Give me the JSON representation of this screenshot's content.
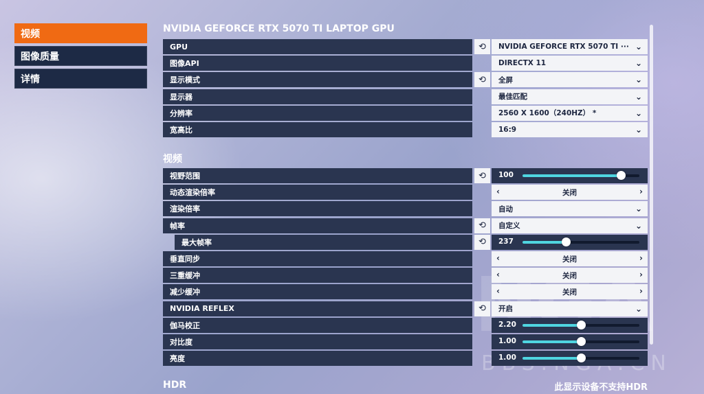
{
  "nav": [
    {
      "label": "视频",
      "active": true
    },
    {
      "label": "图像质量",
      "active": false
    },
    {
      "label": "详情",
      "active": false
    }
  ],
  "gpu_section": {
    "title": "NVIDIA GEFORCE RTX 5070 TI LAPTOP GPU",
    "rows": [
      {
        "label": "GPU",
        "reset": true,
        "type": "dropdown",
        "value": "NVIDIA GEFORCE RTX 5070 TI ···"
      },
      {
        "label": "图像API",
        "reset": false,
        "type": "dropdown",
        "value": "DIRECTX 11"
      },
      {
        "label": "显示模式",
        "reset": true,
        "type": "dropdown",
        "value": "全屏"
      },
      {
        "label": "显示器",
        "reset": false,
        "type": "dropdown",
        "value": "最佳匹配"
      },
      {
        "label": "分辨率",
        "reset": false,
        "type": "dropdown",
        "value": "2560 X 1600（240HZ） *"
      },
      {
        "label": "宽高比",
        "reset": false,
        "type": "dropdown",
        "value": "16:9"
      }
    ]
  },
  "video_section": {
    "title": "视频",
    "rows": [
      {
        "label": "视野范围",
        "reset": true,
        "type": "slider",
        "value": "100",
        "fraction": 0.84
      },
      {
        "label": "动态渲染倍率",
        "reset": false,
        "type": "toggle",
        "value": "关闭"
      },
      {
        "label": "渲染倍率",
        "reset": false,
        "type": "dropdown",
        "value": "自动"
      },
      {
        "label": "帧率",
        "reset": true,
        "type": "dropdown",
        "value": "自定义"
      },
      {
        "label": "最大帧率",
        "reset": true,
        "type": "slider",
        "value": "237",
        "fraction": 0.37,
        "indent": true
      },
      {
        "label": "垂直同步",
        "reset": false,
        "type": "toggle",
        "value": "关闭"
      },
      {
        "label": "三重缓冲",
        "reset": false,
        "type": "toggle",
        "value": "关闭"
      },
      {
        "label": "减少缓冲",
        "reset": false,
        "type": "toggle",
        "value": "关闭"
      },
      {
        "label": "NVIDIA REFLEX",
        "reset": true,
        "type": "dropdown",
        "value": "开启"
      },
      {
        "label": "伽马校正",
        "reset": false,
        "type": "slider",
        "value": "2.20",
        "fraction": 0.5
      },
      {
        "label": "对比度",
        "reset": false,
        "type": "slider",
        "value": "1.00",
        "fraction": 0.5
      },
      {
        "label": "亮度",
        "reset": false,
        "type": "slider",
        "value": "1.00",
        "fraction": 0.5
      }
    ]
  },
  "hdr_section": {
    "title": "HDR",
    "note": "此显示设备不支持HDR"
  },
  "watermark": "BBS.NGA.CN",
  "colors": {
    "accent": "#f06a13",
    "slider_fill": "#4fd5e0",
    "panel": "#2a3550"
  }
}
